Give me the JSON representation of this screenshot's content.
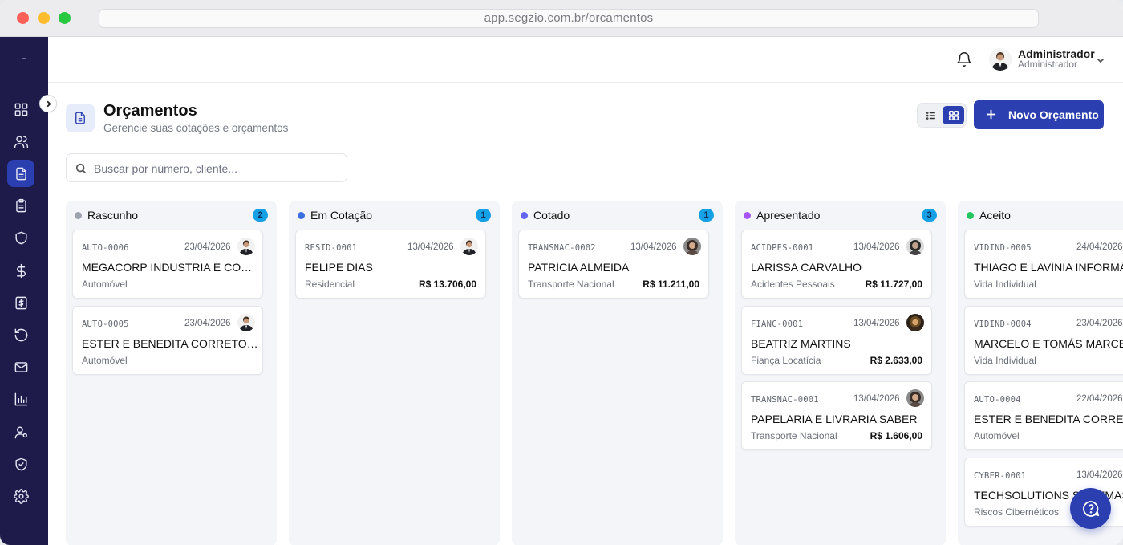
{
  "browser": {
    "url": "app.segzio.com.br/orcamentos"
  },
  "user": {
    "name": "Administrador",
    "role": "Administrador"
  },
  "page": {
    "title": "Orçamentos",
    "subtitle": "Gerencie suas cotações e orçamentos",
    "new_button": "Novo Orçamento",
    "search_placeholder": "Buscar por número, cliente...",
    "view_mode": "kanban"
  },
  "sidebar": {
    "items": [
      {
        "icon": "dashboard-icon",
        "active": false
      },
      {
        "icon": "users-icon",
        "active": false
      },
      {
        "icon": "document-icon",
        "active": true
      },
      {
        "icon": "clipboard-icon",
        "active": false
      },
      {
        "icon": "shield-icon",
        "active": false
      },
      {
        "icon": "dollar-icon",
        "active": false
      },
      {
        "icon": "receipt-dollar-icon",
        "active": false
      },
      {
        "icon": "refresh-icon",
        "active": false
      },
      {
        "icon": "mail-icon",
        "active": false
      },
      {
        "icon": "bar-chart-icon",
        "active": false
      },
      {
        "icon": "user-settings-icon",
        "active": false
      },
      {
        "icon": "shield-check-icon",
        "active": false
      },
      {
        "icon": "settings-icon",
        "active": false
      }
    ]
  },
  "colors": {
    "sidebar_bg": "#1e1b4b",
    "accent": "#2b3fb0",
    "count_badge": "#16a0e6"
  },
  "columns": [
    {
      "title": "Rascunho",
      "count": "2",
      "dot_color": "#9ca3af",
      "cards": [
        {
          "code": "AUTO-0006",
          "date": "23/04/2026",
          "name": "MEGACORP INDUSTRIA E COMERCIO",
          "type": "Automóvel",
          "value": "",
          "avatar": "man"
        },
        {
          "code": "AUTO-0005",
          "date": "23/04/2026",
          "name": "ESTER E BENEDITA CORRETORES",
          "type": "Automóvel",
          "value": "",
          "avatar": "man"
        }
      ]
    },
    {
      "title": "Em Cotação",
      "count": "1",
      "dot_color": "#3b6fe0",
      "cards": [
        {
          "code": "RESID-0001",
          "date": "13/04/2026",
          "name": "FELIPE DIAS",
          "type": "Residencial",
          "value": "R$ 13.706,00",
          "avatar": "man"
        }
      ]
    },
    {
      "title": "Cotado",
      "count": "1",
      "dot_color": "#6366f1",
      "cards": [
        {
          "code": "TRANSNAC-0002",
          "date": "13/04/2026",
          "name": "PATRÍCIA ALMEIDA",
          "type": "Transporte Nacional",
          "value": "R$ 11.211,00",
          "avatar": "woman"
        }
      ]
    },
    {
      "title": "Apresentado",
      "count": "3",
      "dot_color": "#a855f7",
      "cards": [
        {
          "code": "ACIDPES-0001",
          "date": "13/04/2026",
          "name": "LARISSA CARVALHO",
          "type": "Acidentes Pessoais",
          "value": "R$ 11.727,00",
          "avatar": "woman2"
        },
        {
          "code": "FIANC-0001",
          "date": "13/04/2026",
          "name": "BEATRIZ MARTINS",
          "type": "Fiança Locatícia",
          "value": "R$ 2.633,00",
          "avatar": "woman3"
        },
        {
          "code": "TRANSNAC-0001",
          "date": "13/04/2026",
          "name": "PAPELARIA E LIVRARIA SABER",
          "type": "Transporte Nacional",
          "value": "R$ 1.606,00",
          "avatar": "woman"
        }
      ]
    },
    {
      "title": "Aceito",
      "count": "",
      "dot_color": "#22c55e",
      "cards": [
        {
          "code": "VIDIND-0005",
          "date": "24/04/2026",
          "name": "THIAGO E LAVÍNIA INFORMÁTICA",
          "type": "Vida Individual",
          "value": "R$",
          "avatar": ""
        },
        {
          "code": "VIDIND-0004",
          "date": "23/04/2026",
          "name": "MARCELO E TOMÁS MARCENARIA",
          "type": "Vida Individual",
          "value": "R$",
          "avatar": ""
        },
        {
          "code": "AUTO-0004",
          "date": "22/04/2026",
          "name": "ESTER E BENEDITA CORRETORES",
          "type": "Automóvel",
          "value": "",
          "avatar": ""
        },
        {
          "code": "CYBER-0001",
          "date": "13/04/2026",
          "name": "TECHSOLUTIONS SISTEMAS",
          "type": "Riscos Cibernéticos",
          "value": "",
          "avatar": ""
        }
      ]
    }
  ]
}
